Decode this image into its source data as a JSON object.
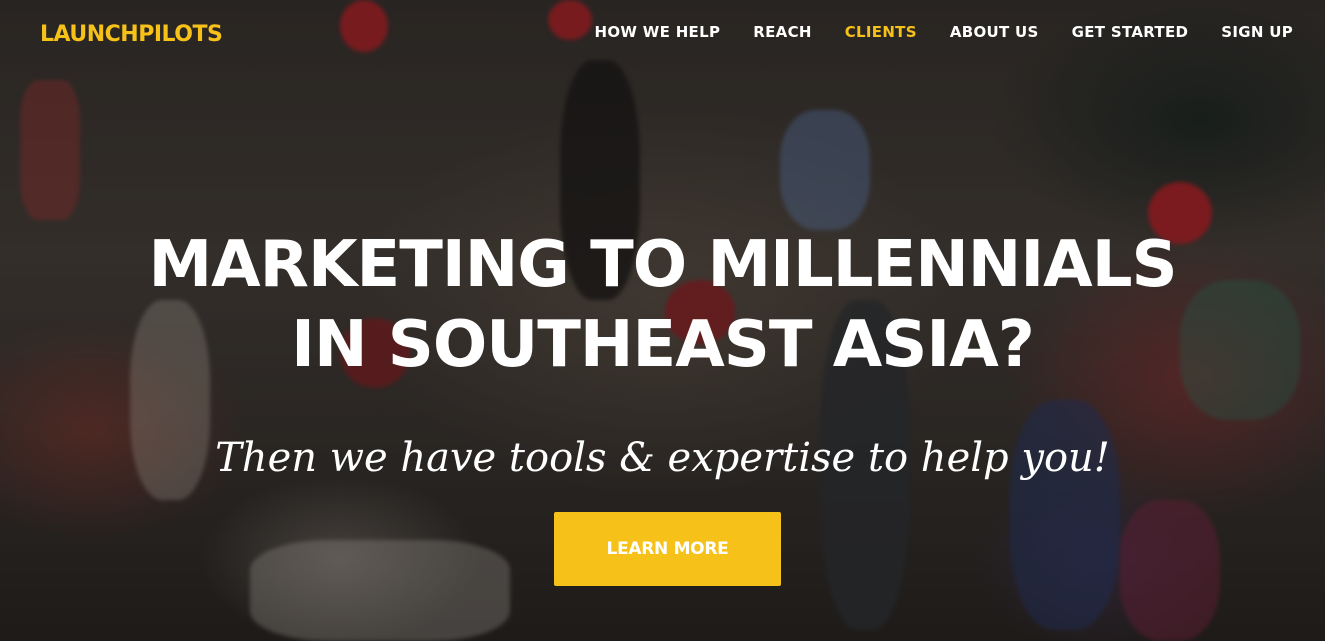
{
  "brand": {
    "name": "LAUNCHPILOTS",
    "accent_color": "#f6c21a"
  },
  "nav": {
    "items": [
      {
        "label": "HOW WE HELP",
        "active": false
      },
      {
        "label": "REACH",
        "active": false
      },
      {
        "label": "CLIENTS",
        "active": true
      },
      {
        "label": "ABOUT US",
        "active": false
      },
      {
        "label": "GET STARTED",
        "active": false
      },
      {
        "label": "SIGN UP",
        "active": false
      }
    ]
  },
  "hero": {
    "headline_line1": "MARKETING TO MILLENNIALS",
    "headline_line2": "IN SOUTHEAST ASIA?",
    "subheadline": "Then we have tools & expertise to help you!",
    "cta_label": "LEARN MORE",
    "background_image": "crowd-photo"
  }
}
